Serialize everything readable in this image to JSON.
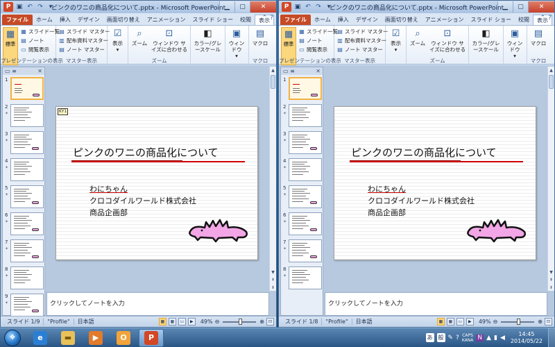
{
  "windows": [
    {
      "title": "ピンクのワニの商品化について.pptx - Microsoft PowerPoint",
      "status_slide": "スライド 1/9",
      "status_theme": "\"Profile\"",
      "status_lang": "日本語",
      "zoom": "49%",
      "slide_tag": "KY1",
      "thumb_count": 9
    },
    {
      "title": "ピンクのワニの商品化について.pptx - Microsoft PowerPoint",
      "status_slide": "スライド 1/8",
      "status_theme": "\"Profile\"",
      "status_lang": "日本語",
      "zoom": "49%",
      "slide_tag": "",
      "thumb_count": 8
    }
  ],
  "tabs": {
    "file": "ファイル",
    "home": "ホーム",
    "insert": "挿入",
    "design": "デザイン",
    "transitions": "画面切り替え",
    "animations": "アニメーション",
    "slideshow": "スライド ショー",
    "review": "校閲",
    "view": "表示"
  },
  "ribbon": {
    "normal": "標準",
    "slide_list": "スライド一覧",
    "notes": "ノート",
    "reading_view": "閲覧表示",
    "group_presentation_views": "プレゼンテーションの表示",
    "slide_master": "スライド マスター",
    "handout_master": "配布資料マスター",
    "notes_master": "ノート マスター",
    "group_master_views": "マスター表示",
    "show": "表示",
    "zoom": "ズーム",
    "fit_window": "ウィンドウ サイズに合わせる",
    "group_zoom": "ズーム",
    "color_gray": "カラー/グレースケール",
    "window": "ウィンドウ",
    "macro": "マクロ",
    "group_macro": "マクロ"
  },
  "slide": {
    "title": "ピンクのワニの商品化について",
    "line1": "わにちゃん",
    "line2": "クロコダイルワールド株式会社",
    "line3": "商品企画部"
  },
  "notes_placeholder": "クリックしてノートを入力",
  "taskbar": {
    "ime_mode": "あ",
    "ime_kana": "般",
    "caps": "CAPS",
    "kana_lock": "KANA",
    "time": "14:45",
    "date": "2014/05/22"
  },
  "colors": {
    "file_tab": "#c64a26",
    "accent_red": "#cc0000",
    "croc_pink": "#f2a6e6"
  }
}
